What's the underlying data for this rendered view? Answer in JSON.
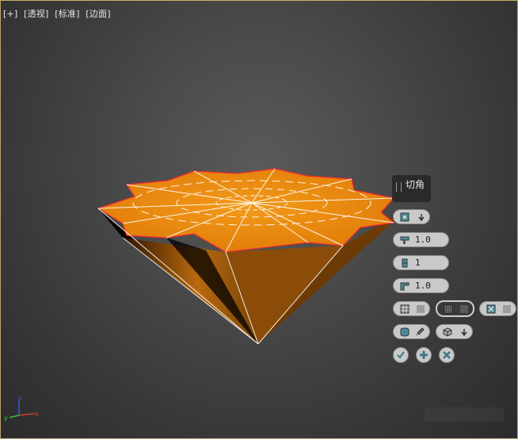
{
  "viewport": {
    "labels": [
      "[+]",
      "[透视]",
      "[标准]",
      "[边面]"
    ]
  },
  "caddy": {
    "title": "切角",
    "amount": "1.0",
    "segments": "1",
    "tension": "1.0"
  },
  "axis": {
    "x": "x",
    "y": "y",
    "z": "z"
  },
  "colors": {
    "mesh_top": "#e88a12",
    "mesh_side": "#9a5208",
    "wire": "#ffffff",
    "selection_edge": "#ff2a2a"
  }
}
